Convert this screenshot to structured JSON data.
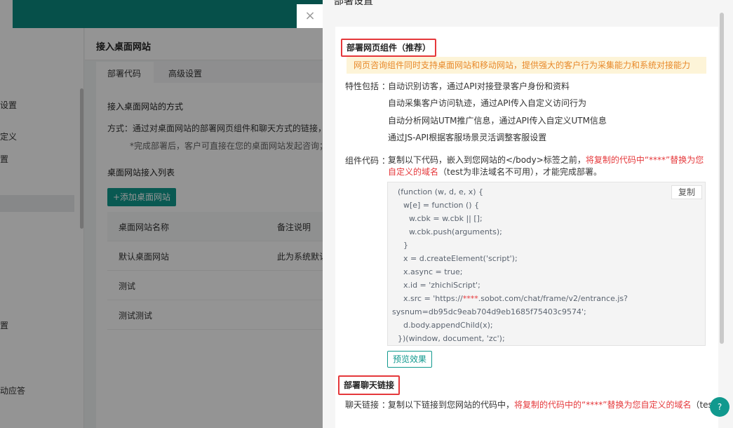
{
  "close_icon": "×",
  "sidebar": {
    "items": [
      {
        "label": "设置"
      },
      {
        "label": "定义"
      },
      {
        "label": "置"
      },
      {
        "label": "置"
      },
      {
        "label": "动应答"
      }
    ]
  },
  "main": {
    "title": "接入桌面网站",
    "tabs": [
      {
        "label": "部署代码"
      },
      {
        "label": "高级设置"
      }
    ],
    "section1_title": "接入桌面网站的方式",
    "method_text": "方式：通过对桌面网站的部署网页组件和聊天方式的链接，即",
    "method_note": "*完成部署后，客户可直接在您的桌面网站发起咨询；接",
    "section2_title": "桌面网站接入列表",
    "add_button": "+添加桌面网站",
    "table": {
      "headers": [
        "桌面网站名称",
        "备注说明"
      ],
      "rows": [
        [
          "默认桌面网站",
          "此为系统默认"
        ],
        [
          "测试",
          ""
        ],
        [
          "测试测试",
          ""
        ]
      ]
    }
  },
  "drawer": {
    "title": "部署设置",
    "section1_title": "部署网页组件（推荐）",
    "notice": "网页咨询组件同时支持桌面网站和移动网站，提供强大的客户行为采集能力和系统对接能力",
    "features_label": "特性包括 ：",
    "features": [
      "自动识别访客，通过API对接登录客户身份和资料",
      "自动采集客户访问轨迹，通过API传入自定义访问行为",
      "自动分析网站UTM推广信息，通过API传入自定义UTM信息",
      "通过JS-API根据客服场景灵活调整客服设置"
    ],
    "code_label": "组件代码 ：",
    "code_desc_part1": "复制以下代码，嵌入到您网站的</body>标签之前，",
    "code_desc_red": "将复制的代码中“****”替换为您自定义的域名",
    "code_desc_part2": "（test为非法域名不可用），才能完成部署。",
    "copy_button": "复制",
    "code_lines": [
      "(function (w, d, e, x) {",
      "w[e] = function () {",
      "w.cbk = w.cbk || [];",
      "w.cbk.push(arguments);",
      "}",
      "x = d.createElement('script');",
      "x.async = true;",
      "x.id = 'zhichiScript';",
      "x.src = 'https://",
      "****",
      ".sobot.com/chat/frame/v2/entrance.js?",
      "sysnum=db95dc9eab704d9eb1685f75403c9574';",
      "d.body.appendChild(x);",
      "})(window, document, 'zc');"
    ],
    "preview_button": "预览效果",
    "section2_title": "部署聊天链接",
    "chat_label": "聊天链接 ：",
    "chat_desc_part1": "复制以下链接到您网站的代码中，",
    "chat_desc_red": "将复制的代码中的“****”替换为您自定义的域名",
    "chat_desc_part2": "（test"
  },
  "help_icon": "?",
  "colors": {
    "brand": "#11998e",
    "topbar": "#0b8a80",
    "highlight": "#e5383b",
    "notice_bg": "#fdf4d8",
    "notice_text": "#e8892a"
  }
}
